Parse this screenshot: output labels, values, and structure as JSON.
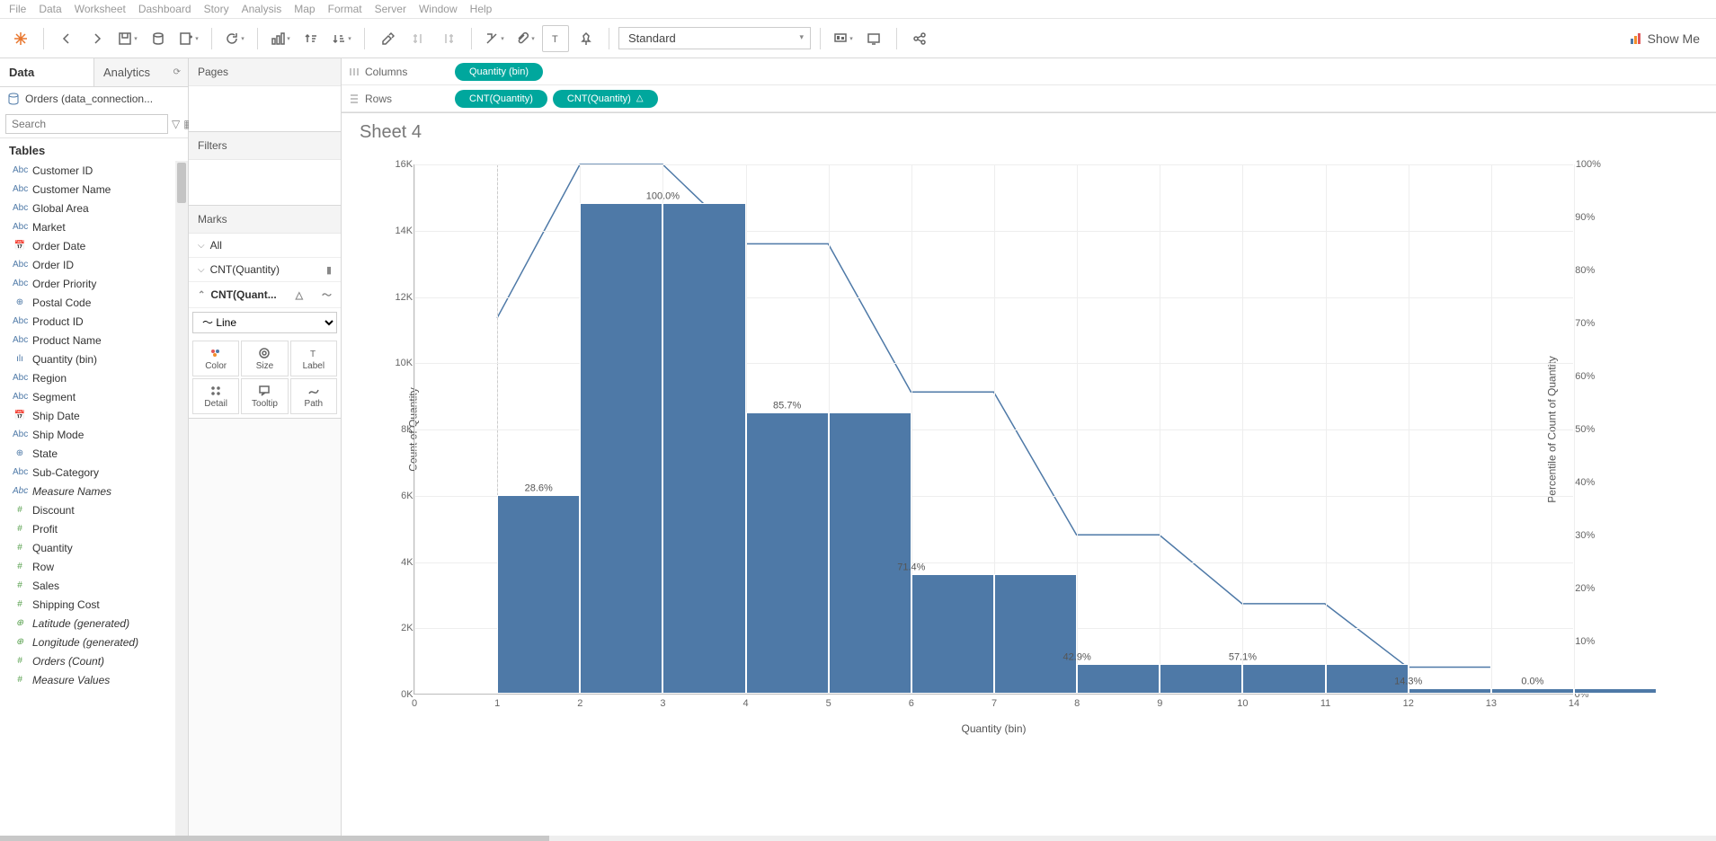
{
  "menu": [
    "File",
    "Data",
    "Worksheet",
    "Dashboard",
    "Story",
    "Analysis",
    "Map",
    "Format",
    "Server",
    "Window",
    "Help"
  ],
  "toolbar": {
    "fit": "Standard",
    "showme": "Show Me"
  },
  "side": {
    "tabs": {
      "data": "Data",
      "analytics": "Analytics"
    },
    "datasource": "Orders (data_connection...",
    "search_placeholder": "Search",
    "tables_hdr": "Tables",
    "fields": [
      {
        "t": "abc",
        "n": "Customer ID"
      },
      {
        "t": "abc",
        "n": "Customer Name"
      },
      {
        "t": "abc",
        "n": "Global Area"
      },
      {
        "t": "abc",
        "n": "Market"
      },
      {
        "t": "date",
        "n": "Order Date"
      },
      {
        "t": "abc",
        "n": "Order ID"
      },
      {
        "t": "abc",
        "n": "Order Priority"
      },
      {
        "t": "geo",
        "n": "Postal Code"
      },
      {
        "t": "abc",
        "n": "Product ID"
      },
      {
        "t": "abc",
        "n": "Product Name"
      },
      {
        "t": "bin",
        "n": "Quantity (bin)"
      },
      {
        "t": "abc",
        "n": "Region"
      },
      {
        "t": "abc",
        "n": "Segment"
      },
      {
        "t": "date",
        "n": "Ship Date"
      },
      {
        "t": "abc",
        "n": "Ship Mode"
      },
      {
        "t": "geo",
        "n": "State"
      },
      {
        "t": "abc",
        "n": "Sub-Category"
      },
      {
        "t": "abc",
        "n": "Measure Names",
        "ital": true
      },
      {
        "t": "num",
        "n": "Discount"
      },
      {
        "t": "num",
        "n": "Profit"
      },
      {
        "t": "num",
        "n": "Quantity"
      },
      {
        "t": "num",
        "n": "Row"
      },
      {
        "t": "num",
        "n": "Sales"
      },
      {
        "t": "num",
        "n": "Shipping Cost"
      },
      {
        "t": "numgeo",
        "n": "Latitude (generated)",
        "ital": true
      },
      {
        "t": "numgeo",
        "n": "Longitude (generated)",
        "ital": true
      },
      {
        "t": "num",
        "n": "Orders (Count)",
        "ital": true
      },
      {
        "t": "num",
        "n": "Measure Values",
        "ital": true
      }
    ]
  },
  "shelves": {
    "pages": "Pages",
    "filters": "Filters",
    "marks": "Marks",
    "all": "All",
    "m1": "CNT(Quantity)",
    "m2": "CNT(Quant...",
    "type": "Line",
    "cells": [
      "Color",
      "Size",
      "Label",
      "Detail",
      "Tooltip",
      "Path"
    ]
  },
  "colrows": {
    "columns": "Columns",
    "rows": "Rows",
    "col_pill": "Quantity (bin)",
    "row_pill1": "CNT(Quantity)",
    "row_pill2": "CNT(Quantity)"
  },
  "viz": {
    "title": "Sheet 4"
  },
  "chart_data": {
    "type": "bar",
    "title": "Sheet 4",
    "xlabel": "Quantity (bin)",
    "ylabel": "Count of Quantity",
    "ylabel2": "Percentile of Count of Quantity",
    "xticks": [
      0,
      1,
      2,
      3,
      4,
      5,
      6,
      7,
      8,
      9,
      10,
      11,
      12,
      13,
      14
    ],
    "yticks": [
      "0K",
      "2K",
      "4K",
      "6K",
      "8K",
      "10K",
      "12K",
      "14K",
      "16K"
    ],
    "y2ticks": [
      "0%",
      "10%",
      "20%",
      "30%",
      "40%",
      "50%",
      "60%",
      "70%",
      "80%",
      "90%",
      "100%"
    ],
    "ylim": [
      0,
      16000
    ],
    "y2lim": [
      0,
      100
    ],
    "series": [
      {
        "name": "Count of Quantity",
        "type": "bar",
        "x": [
          1,
          2,
          3,
          4,
          5,
          6,
          7,
          8,
          9,
          10,
          11,
          12,
          13,
          14
        ],
        "values": [
          6000,
          14800,
          14800,
          8500,
          8500,
          3600,
          3600,
          900,
          900,
          900,
          900,
          150,
          150,
          150
        ]
      },
      {
        "name": "Percentile of Count of Quantity",
        "type": "line",
        "x": [
          1,
          2,
          3,
          4,
          5,
          6,
          7,
          8,
          9,
          10,
          11,
          12,
          13
        ],
        "values": [
          71,
          100,
          100,
          85,
          85,
          57,
          57,
          30,
          30,
          17,
          17,
          5,
          5
        ]
      }
    ],
    "labels": [
      {
        "x": 1.5,
        "text": "28.6%"
      },
      {
        "x": 3.0,
        "text": "100.0%"
      },
      {
        "x": 4.5,
        "text": "85.7%"
      },
      {
        "x": 6.0,
        "text": "71.4%"
      },
      {
        "x": 8.0,
        "text": "42.9%"
      },
      {
        "x": 10.0,
        "text": "57.1%"
      },
      {
        "x": 12.0,
        "text": "14.3%"
      },
      {
        "x": 13.5,
        "text": "0.0%"
      }
    ]
  }
}
